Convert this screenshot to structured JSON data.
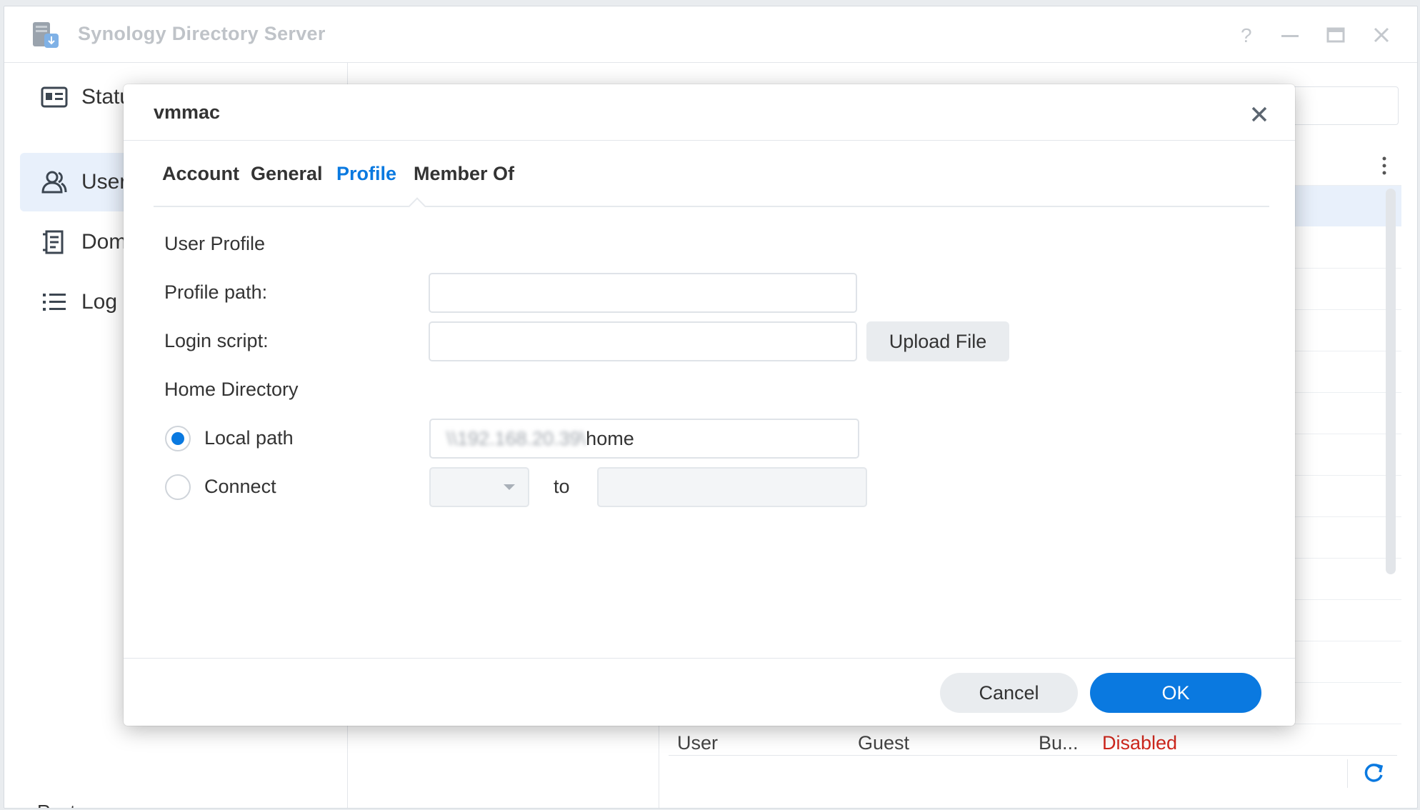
{
  "window": {
    "title": "Synology Directory Server"
  },
  "sidebar": {
    "items": [
      {
        "label": "Statu",
        "icon": "status-card-icon"
      },
      {
        "label": "User",
        "icon": "users-icon"
      },
      {
        "label": "Dom",
        "icon": "domain-icon"
      },
      {
        "label": "Log",
        "icon": "list-icon"
      }
    ],
    "bottom_text": "Rusty"
  },
  "background_table": {
    "visible_row": {
      "type": "User",
      "name": "Guest",
      "desc": "Bu...",
      "status": "Disabled"
    }
  },
  "dialog": {
    "title": "vmmac",
    "tabs": [
      "Account",
      "General",
      "Profile",
      "Member Of"
    ],
    "active_tab": "Profile",
    "user_profile": {
      "section": "User Profile",
      "profile_path_label": "Profile path:",
      "profile_path_value": "",
      "login_script_label": "Login script:",
      "login_script_value": "",
      "upload_button": "Upload File"
    },
    "home_directory": {
      "section": "Home Directory",
      "local_path_label": "Local path",
      "local_path_prefix": "\\\\192.168.20.39\\",
      "local_path_suffix": "home",
      "connect_label": "Connect",
      "connect_drive": "",
      "to_label": "to",
      "connect_path": ""
    },
    "buttons": {
      "cancel": "Cancel",
      "ok": "OK"
    }
  },
  "colors": {
    "accent": "#0a79e0",
    "danger": "#d0271d",
    "title_gray": "#bfc3c8"
  }
}
